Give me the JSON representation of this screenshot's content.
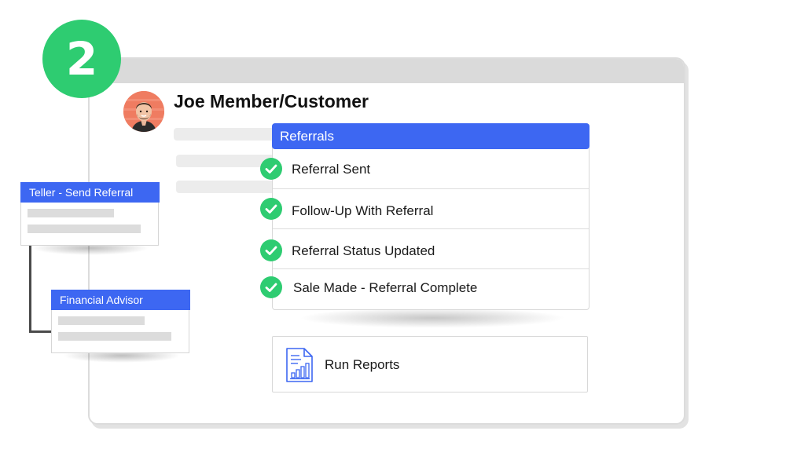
{
  "step": {
    "number": "2",
    "color": "#2ecc71"
  },
  "customer": {
    "name": "Joe Member/Customer"
  },
  "referrals": {
    "title": "Referrals",
    "header_color": "#3d67f2",
    "items": [
      {
        "label": "Referral Sent",
        "status": "complete",
        "icon": "check-circle-icon"
      },
      {
        "label": "Follow-Up With Referral",
        "status": "complete",
        "icon": "check-circle-icon"
      },
      {
        "label": "Referral Status Updated",
        "status": "complete",
        "icon": "check-circle-icon"
      },
      {
        "label": "Sale Made - Referral Complete",
        "status": "complete",
        "icon": "check-circle-icon"
      }
    ]
  },
  "reports": {
    "label": "Run Reports",
    "icon": "report-chart-icon"
  },
  "roles": [
    {
      "title": "Teller - Send Referral"
    },
    {
      "title": "Financial Advisor"
    }
  ]
}
